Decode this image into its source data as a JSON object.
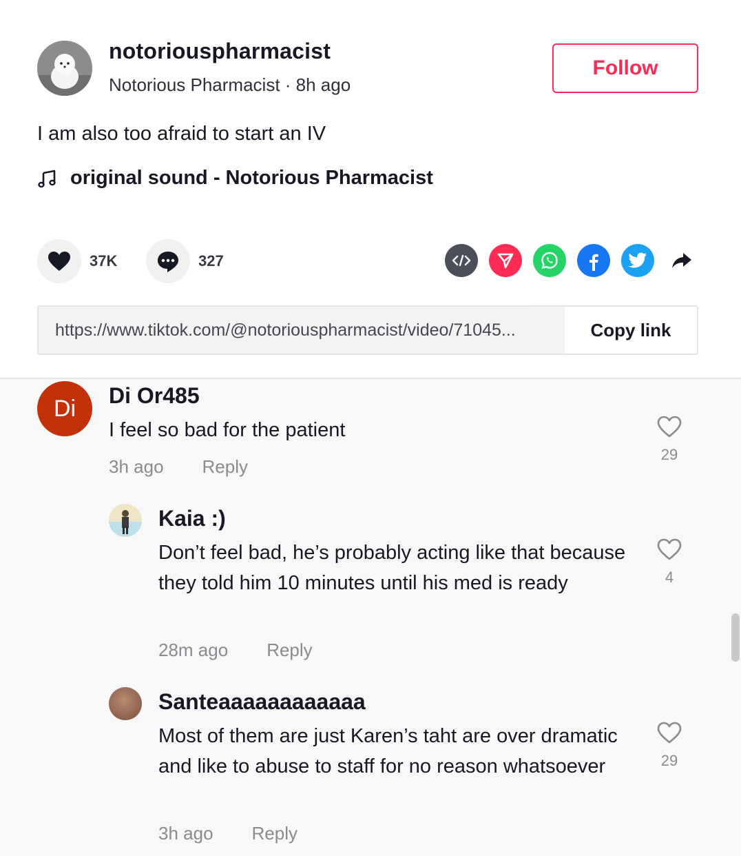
{
  "post": {
    "username": "notoriouspharmacist",
    "subline": "Notorious Pharmacist · 8h ago",
    "follow_label": "Follow",
    "caption": "I am also too afraid to start an IV",
    "music": "original sound - Notorious Pharmacist",
    "likes": "37K",
    "comments": "327",
    "link_url": "https://www.tiktok.com/@notoriouspharmacist/video/71045...",
    "copy_label": "Copy link"
  },
  "colors": {
    "accent": "#fe2c55",
    "embed": "#4b4f58",
    "send": "#fe2c55",
    "whatsapp": "#25d366",
    "facebook": "#1877f2",
    "twitter": "#1da1f2"
  },
  "share_icons": [
    "embed-icon",
    "send-icon",
    "whatsapp-icon",
    "facebook-icon",
    "twitter-icon",
    "share-arrow-icon"
  ],
  "comments": [
    {
      "avatar_text": "Di",
      "name": "Di Or485",
      "text": "I feel so bad for the patient",
      "time": "3h ago",
      "reply": "Reply",
      "likes": "29"
    },
    {
      "name": "Kaia :)",
      "text": "Don’t feel bad, he’s probably acting like that because they told him 10 minutes until his med is ready",
      "time": "28m ago",
      "reply": "Reply",
      "likes": "4"
    },
    {
      "name": "Santeaaaaaaaaaaaa",
      "text": "Most of them are just Karen’s taht are over dramatic and like to abuse to staff for no reason whatsoever",
      "time": "3h ago",
      "reply": "Reply",
      "likes": "29"
    }
  ]
}
